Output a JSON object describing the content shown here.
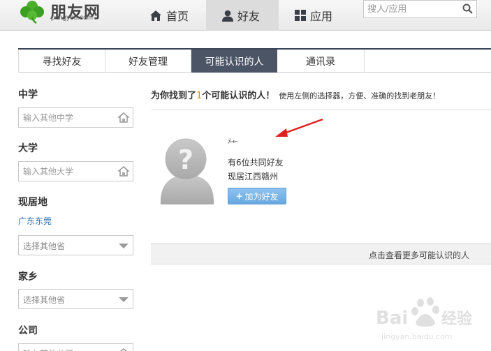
{
  "header": {
    "logo_text": "朋友网",
    "logo_subtext": "pengyou.com",
    "nav": [
      {
        "label": "首页",
        "icon": "home-icon"
      },
      {
        "label": "好友",
        "icon": "person-icon",
        "active": true
      },
      {
        "label": "应用",
        "icon": "apps-grid-icon"
      }
    ],
    "search_placeholder": "搜人/应用"
  },
  "tabs": [
    {
      "label": "寻找好友",
      "active": false
    },
    {
      "label": "好友管理",
      "active": false
    },
    {
      "label": "可能认识的人",
      "active": true
    },
    {
      "label": "通讯录",
      "active": false
    }
  ],
  "sidebar": {
    "middle_school": {
      "title": "中学",
      "placeholder": "输入其他中学"
    },
    "university": {
      "title": "大学",
      "placeholder": "输入其他大学"
    },
    "residence": {
      "title": "现居地",
      "current": "广东东莞",
      "select": "选择其他省"
    },
    "hometown": {
      "title": "家乡",
      "select": "选择其他省"
    },
    "company": {
      "title": "公司",
      "placeholder": "输入其他公司"
    }
  },
  "main": {
    "headline_prefix": "为你找到了",
    "headline_count": "1",
    "headline_suffix": "个可能认识的人！",
    "headline_sub": "使用左侧的选择器，方便、准确的找到老朋友！",
    "person": {
      "name": "ﾒ-←",
      "mutual_friends": "有6位共同好友",
      "location": "现居江西赣州",
      "add_button": "加为好友"
    },
    "more_link": "点击查看更多可能认识的人"
  },
  "colors": {
    "accent_orange": "#e7880a",
    "tab_active": "#4c5565",
    "button_blue": "#68a8df",
    "annotation_red": "#e02020",
    "logo_green": "#4caf2c"
  }
}
